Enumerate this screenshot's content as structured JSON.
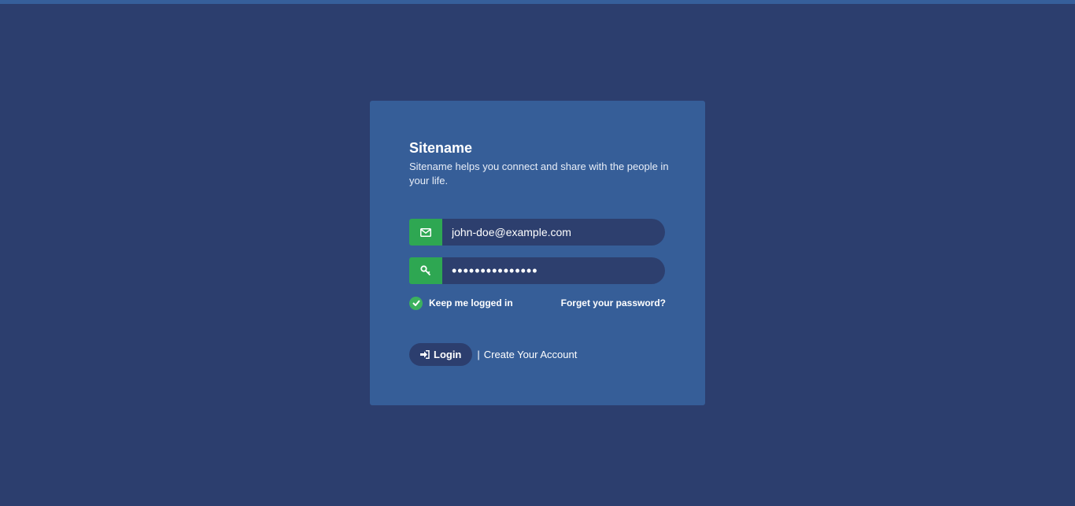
{
  "header": {
    "title": "Sitename",
    "description": "Sitename helps you connect and share with the people in your life."
  },
  "form": {
    "email_value": "john-doe@example.com",
    "password_value": "passwordpasswor",
    "keep_logged_label": "Keep me logged in",
    "keep_logged_checked": true,
    "forgot_label": "Forget your password?",
    "login_label": "Login",
    "separator": "|",
    "create_account_label": "Create Your Account"
  },
  "icons": {
    "email": "envelope-icon",
    "password": "key-icon",
    "checkbox": "check-icon",
    "login": "sign-in-icon"
  },
  "colors": {
    "background": "#2c3e6e",
    "card": "#365e98",
    "accent_green": "#2ea752",
    "input_bg": "#2d3f6e"
  }
}
